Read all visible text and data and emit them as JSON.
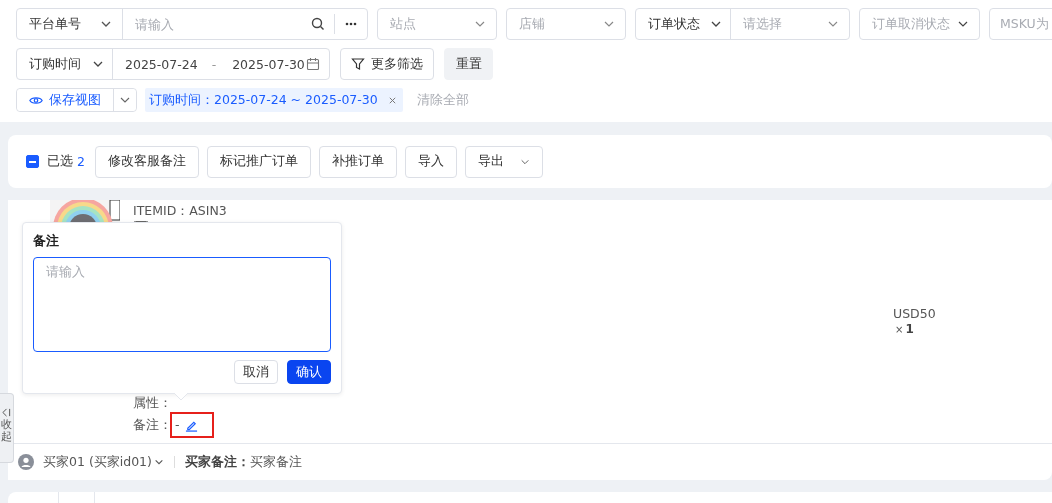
{
  "search": {
    "field_label": "平台单号",
    "placeholder": "请输入"
  },
  "selects": [
    {
      "kind": "select",
      "placeholder": "站点"
    },
    {
      "kind": "select",
      "placeholder": "店铺"
    },
    {
      "kind": "compound",
      "label": "订单状态",
      "placeholder": "请选择"
    },
    {
      "kind": "select",
      "placeholder": "订单取消状态"
    },
    {
      "kind": "cut",
      "placeholder": "MSKU为"
    }
  ],
  "date_filter": {
    "label": "订购时间",
    "start": "2025-07-24",
    "separator": "-",
    "end": "2025-07-30"
  },
  "more_filters": "更多筛选",
  "reset": "重置",
  "save_view": "保存视图",
  "active_filter_tag": "订购时间：2025-07-24 ~ 2025-07-30",
  "clear_all": "清除全部",
  "selection": {
    "indeterminate": true,
    "label": "已选",
    "count": "2"
  },
  "actions": [
    {
      "kind": "button",
      "label": "修改客服备注"
    },
    {
      "kind": "button",
      "label": "标记推广订单"
    },
    {
      "kind": "button",
      "label": "补推订单"
    },
    {
      "kind": "button",
      "label": "导入"
    },
    {
      "kind": "dropdown",
      "label": "导出"
    }
  ],
  "order": {
    "item_id": "ITEMID：ASIN3",
    "attribute_label": "属性：",
    "remark_label": "备注：",
    "remark_value": "-",
    "price": "USD50",
    "quantity_sign": "×",
    "quantity": "1",
    "buyer": "买家01 (买家id01)",
    "buyer_note_label": "买家备注：",
    "buyer_note": "买家备注"
  },
  "popover": {
    "title": "备注",
    "placeholder": "请输入",
    "cancel": "取消",
    "confirm": "确认"
  },
  "side_tab": {
    "label": "收起"
  }
}
